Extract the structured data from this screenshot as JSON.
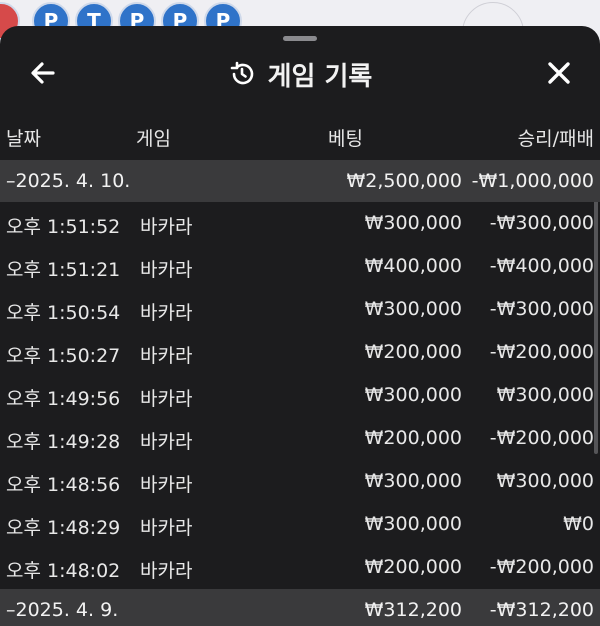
{
  "background": {
    "badges": [
      "P",
      "T",
      "P",
      "P",
      "P"
    ]
  },
  "header": {
    "title": "게임 기록",
    "back_icon": "arrow-left-icon",
    "history_icon": "history-clock-icon",
    "close_icon": "close-x-icon"
  },
  "columns": {
    "date": "날짜",
    "game": "게임",
    "bet": "베팅",
    "result": "승리/패배"
  },
  "groups": [
    {
      "date": "–2025. 4. 10.",
      "bet_total": "₩2,500,000",
      "result_total": "-₩1,000,000",
      "rows": [
        {
          "time": "오후 1:51:52",
          "game": "바카라",
          "bet": "₩300,000",
          "result": "-₩300,000"
        },
        {
          "time": "오후 1:51:21",
          "game": "바카라",
          "bet": "₩400,000",
          "result": "-₩400,000"
        },
        {
          "time": "오후 1:50:54",
          "game": "바카라",
          "bet": "₩300,000",
          "result": "-₩300,000"
        },
        {
          "time": "오후 1:50:27",
          "game": "바카라",
          "bet": "₩200,000",
          "result": "-₩200,000"
        },
        {
          "time": "오후 1:49:56",
          "game": "바카라",
          "bet": "₩300,000",
          "result": "₩300,000"
        },
        {
          "time": "오후 1:49:28",
          "game": "바카라",
          "bet": "₩200,000",
          "result": "-₩200,000"
        },
        {
          "time": "오후 1:48:56",
          "game": "바카라",
          "bet": "₩300,000",
          "result": "₩300,000"
        },
        {
          "time": "오후 1:48:29",
          "game": "바카라",
          "bet": "₩300,000",
          "result": "₩0"
        },
        {
          "time": "오후 1:48:02",
          "game": "바카라",
          "bet": "₩200,000",
          "result": "-₩200,000"
        }
      ]
    },
    {
      "date": "–2025. 4. 9.",
      "bet_total": "₩312,200",
      "result_total": "-₩312,200",
      "rows": []
    }
  ]
}
